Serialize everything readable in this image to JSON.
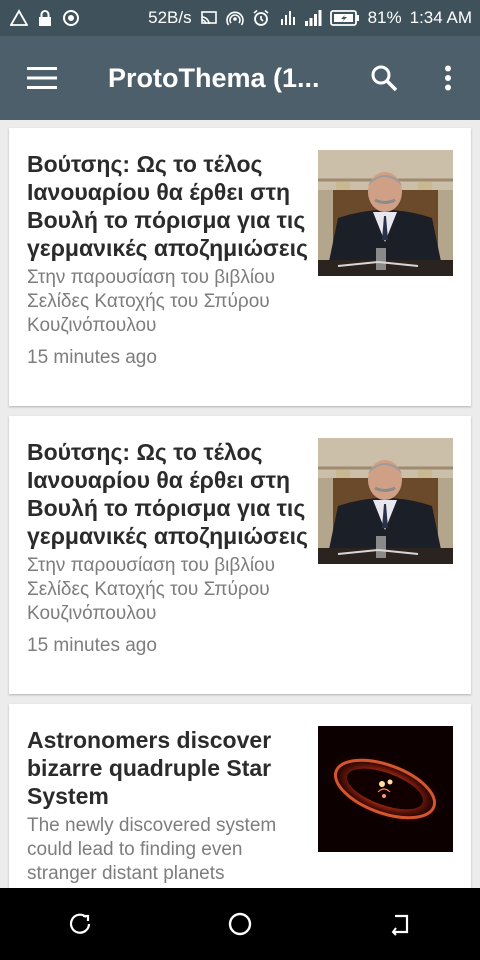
{
  "status_bar": {
    "speed": "52B/s",
    "battery_percent": "81%",
    "time": "1:34 AM",
    "icons": [
      "warning-icon",
      "lock-icon",
      "record-icon",
      "cast-icon",
      "hotspot-icon",
      "alarm-icon",
      "data-signal-icon",
      "cell-signal-icon",
      "battery-icon"
    ]
  },
  "app_bar": {
    "title": "ProtoThema (1...",
    "icons": [
      "menu-icon",
      "search-icon",
      "more-vert-icon"
    ]
  },
  "articles": [
    {
      "headline": "Βούτσης: Ως το τέλος Ιανουαρίου θα έρθει στη Βουλή το πόρισμα για τις γερμανικές αποζημιώσεις",
      "summary": "Στην παρουσίαση του βιβλίου Σελίδες Κατοχής του Σπύρου Κουζινόπουλου",
      "time": "15 minutes ago",
      "thumbnail": "politician-photo"
    },
    {
      "headline": "Βούτσης: Ως το τέλος Ιανουαρίου θα έρθει στη Βουλή το πόρισμα για τις γερμανικές αποζημιώσεις",
      "summary": "Στην παρουσίαση του βιβλίου Σελίδες Κατοχής του Σπύρου Κουζινόπουλου",
      "time": "15 minutes ago",
      "thumbnail": "politician-photo"
    },
    {
      "headline": "Astronomers discover bizarre quadruple Star System",
      "summary": "The newly discovered system could lead to finding even stranger distant planets",
      "time": "",
      "thumbnail": "star-system-illustration"
    }
  ],
  "nav_bar": {
    "icons": [
      "recent-apps-icon",
      "home-icon",
      "back-icon"
    ]
  },
  "colors": {
    "status_bar": "#3f525c",
    "app_bar": "#4c5f6a",
    "background": "#ececec",
    "headline": "#2b2b2b",
    "meta_text": "#7d7d7d"
  }
}
